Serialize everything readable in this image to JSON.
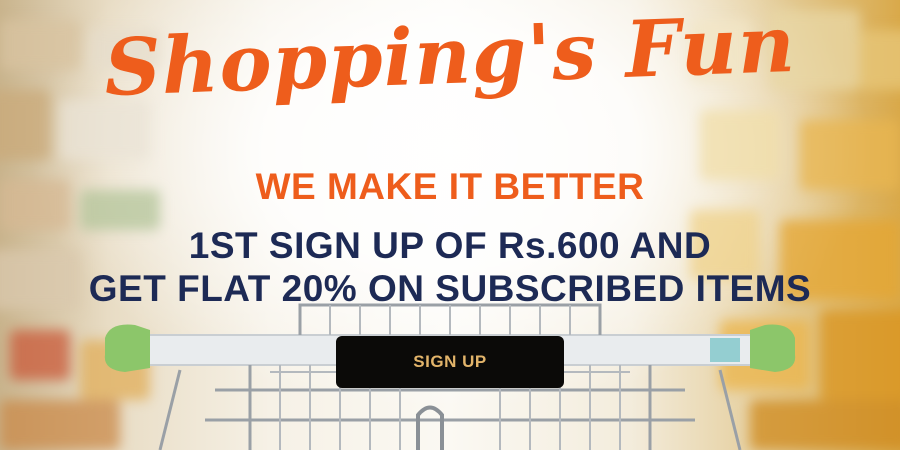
{
  "headline": "Shopping's Fun",
  "subheadline": "WE MAKE IT BETTER",
  "offer": {
    "line1": "1ST SIGN UP OF Rs.600 AND",
    "line2": "GET FLAT 20% ON SUBSCRIBED ITEMS"
  },
  "cta": {
    "label": "SIGN UP"
  },
  "colors": {
    "headline": "#ee5d1c",
    "subheadline": "#ee5d1c",
    "offer": "#1d2a55",
    "button_bg": "#0b0a08",
    "button_text": "#e2b46a",
    "cart_handle": "#e9ecee",
    "cart_green": "#8cc66a",
    "cart_metal": "#9aa0a6"
  },
  "icons": {
    "background": "shopping-cart-image"
  }
}
